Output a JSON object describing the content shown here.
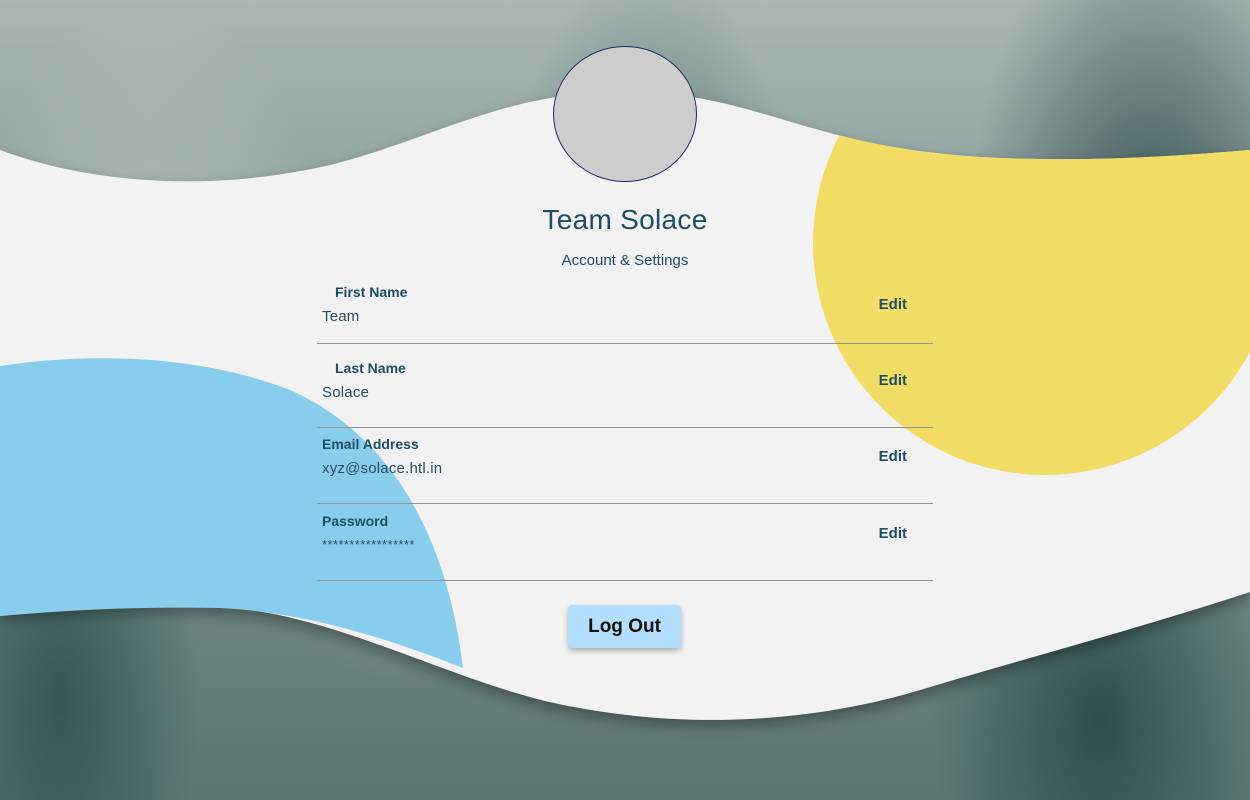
{
  "profile": {
    "name": "Team Solace",
    "subtitle": "Account & Settings"
  },
  "fields": [
    {
      "label": "First Name",
      "value": "Team",
      "edit_label": "Edit"
    },
    {
      "label": "Last Name",
      "value": "Solace",
      "edit_label": "Edit"
    },
    {
      "label": "Email Address",
      "value": "xyz@solace.htl.in",
      "edit_label": "Edit"
    },
    {
      "label": "Password",
      "value": "*****************",
      "edit_label": "Edit"
    }
  ],
  "actions": {
    "logout_label": "Log Out"
  },
  "colors": {
    "panel": "#f2f2f2",
    "accent_yellow": "#f2dc63",
    "accent_blue": "#88ceec",
    "text_primary": "#1e4d66",
    "button_bg": "#b3defe"
  }
}
